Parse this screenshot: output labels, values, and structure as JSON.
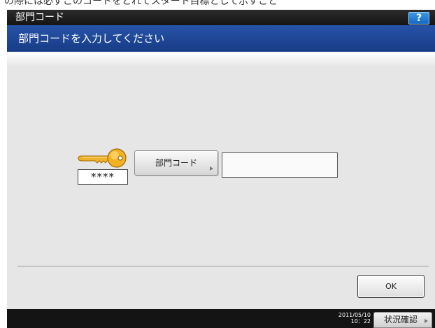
{
  "window": {
    "title": "部門コード"
  },
  "header": {
    "help_label": "?",
    "message": "部門コードを入力してください"
  },
  "top_strip": {
    "partial_text": "の際には必ずこのコードをとれてスタート目標として示すこと"
  },
  "form": {
    "key_icon": "key-icon",
    "masked_code": "****",
    "code_button_label": "部門コード",
    "code_value": ""
  },
  "actions": {
    "ok_label": "OK"
  },
  "status_bar": {
    "date": "2011/05/10",
    "time": "10：22",
    "status_button_label": "状況確認"
  },
  "colors": {
    "titlebar": "#1e1e1e",
    "header_blue": "#1f4a99",
    "help_blue": "#1f80dc",
    "panel": "#e6e6e6",
    "key_gold": "#f3b223"
  }
}
